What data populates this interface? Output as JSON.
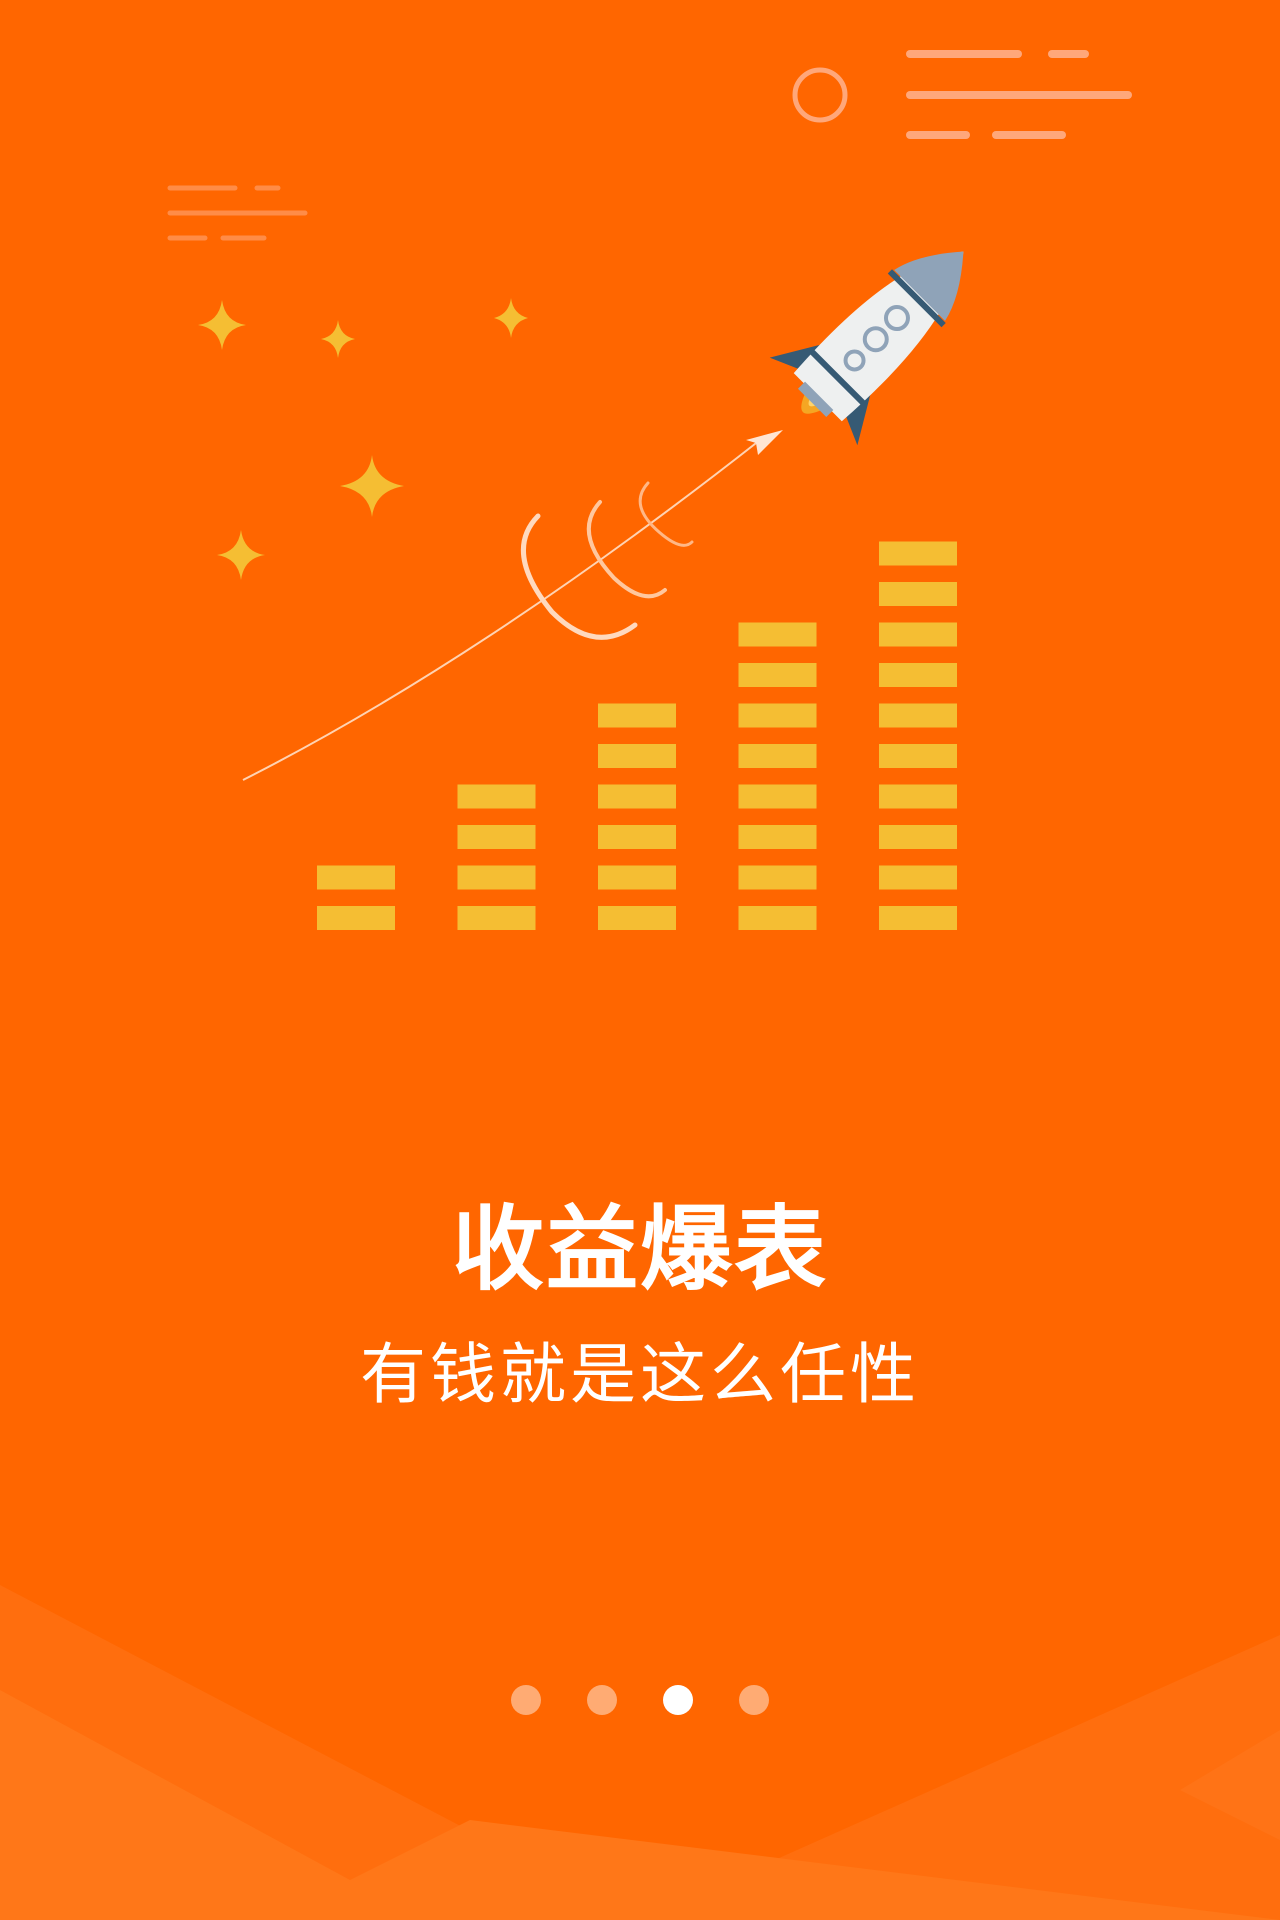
{
  "onboarding": {
    "title": "收益爆表",
    "subtitle": "有钱就是这么任性",
    "pager": {
      "pages": 4,
      "active_index": 2
    }
  },
  "illustration": {
    "bar_levels": [
      2,
      4,
      6,
      8,
      10
    ],
    "icons": [
      "rocket-icon",
      "growth-arrow-icon",
      "sparkle-star-icon",
      "circle-decoration"
    ]
  },
  "colors": {
    "background": "#FF6600",
    "bars": "#F5BE33",
    "stars": "#F5BE33",
    "text": "#FFFFFF",
    "decor_lines": "#FFA77A",
    "rocket_body": "#EEF0F0",
    "rocket_nose": "#8FA3B8",
    "rocket_fins": "#365A74"
  }
}
